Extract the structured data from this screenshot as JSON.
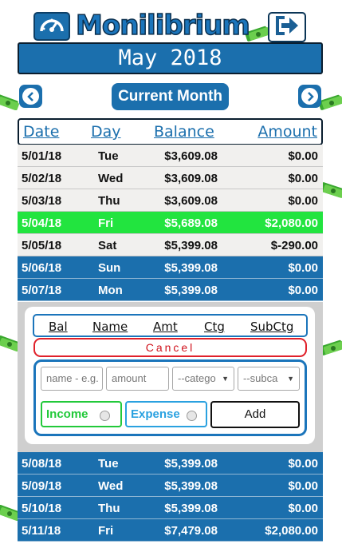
{
  "app": {
    "title": "Monilibrium",
    "dashboard_icon": "speedometer-icon",
    "logout_icon": "logout-icon"
  },
  "month_banner": "May 2018",
  "nav": {
    "prev_icon": "chevron-left-icon",
    "next_icon": "chevron-right-icon",
    "current_month_label": "Current Month"
  },
  "columns": {
    "date": "Date",
    "day": "Day",
    "balance": "Balance",
    "amount": "Amount"
  },
  "rows_before": [
    {
      "date": "5/01/18",
      "day": "Tue",
      "balance": "$3,609.08",
      "amount": "$0.00",
      "style": "plain"
    },
    {
      "date": "5/02/18",
      "day": "Wed",
      "balance": "$3,609.08",
      "amount": "$0.00",
      "style": "plain"
    },
    {
      "date": "5/03/18",
      "day": "Thu",
      "balance": "$3,609.08",
      "amount": "$0.00",
      "style": "plain"
    },
    {
      "date": "5/04/18",
      "day": "Fri",
      "balance": "$5,689.08",
      "amount": "$2,080.00",
      "style": "income"
    },
    {
      "date": "5/05/18",
      "day": "Sat",
      "balance": "$5,399.08",
      "amount": "$-290.00",
      "style": "plain"
    },
    {
      "date": "5/06/18",
      "day": "Sun",
      "balance": "$5,399.08",
      "amount": "$0.00",
      "style": "future"
    },
    {
      "date": "5/07/18",
      "day": "Mon",
      "balance": "$5,399.08",
      "amount": "$0.00",
      "style": "future"
    }
  ],
  "entry_panel": {
    "field_tabs": [
      "Bal",
      "Name",
      "Amt",
      "Ctg",
      "SubCtg"
    ],
    "cancel_label": "Cancel",
    "name_placeholder": "name - e.g.",
    "amount_placeholder": "amount",
    "category_selected": "--catego",
    "subcategory_selected": "--subca",
    "income_label": "Income",
    "expense_label": "Expense",
    "add_label": "Add"
  },
  "rows_after": [
    {
      "date": "5/08/18",
      "day": "Tue",
      "balance": "$5,399.08",
      "amount": "$0.00",
      "style": "future"
    },
    {
      "date": "5/09/18",
      "day": "Wed",
      "balance": "$5,399.08",
      "amount": "$0.00",
      "style": "future"
    },
    {
      "date": "5/10/18",
      "day": "Thu",
      "balance": "$5,399.08",
      "amount": "$0.00",
      "style": "future"
    },
    {
      "date": "5/11/18",
      "day": "Fri",
      "balance": "$7,479.08",
      "amount": "$2,080.00",
      "style": "future"
    }
  ],
  "colors": {
    "primary": "#1b6fad",
    "income_highlight": "#22e43f",
    "cancel_red": "#e0202a",
    "income_green": "#22c93a",
    "expense_blue": "#2aa1e0"
  }
}
